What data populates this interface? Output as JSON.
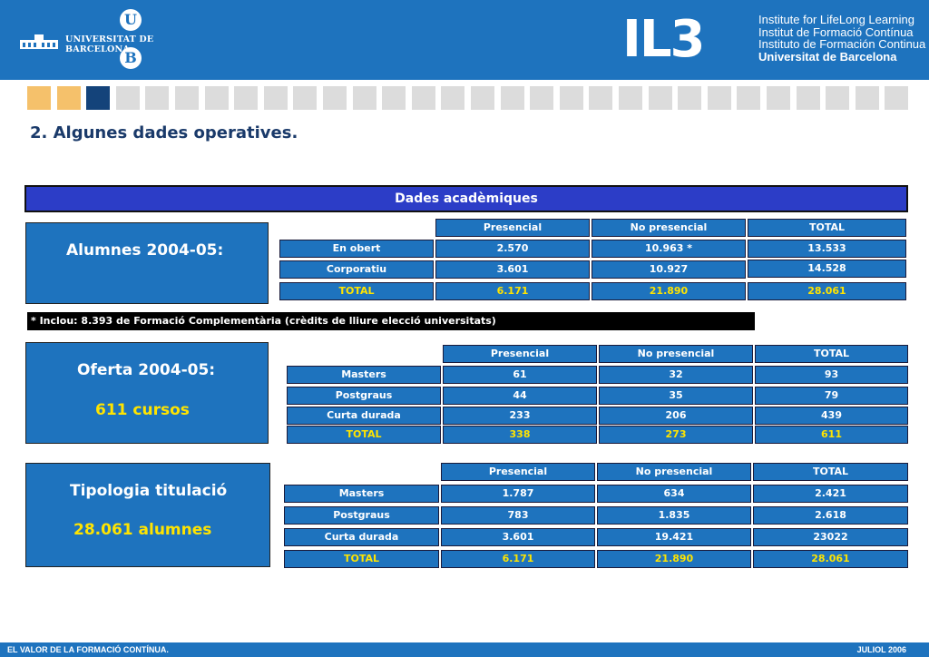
{
  "header": {
    "ub_letters": [
      "U",
      "B"
    ],
    "ub_name": "UNIVERSITAT DE BARCELONA",
    "il3": "IL3",
    "il3_lines": [
      "Institute for LifeLong Learning",
      "Institut de Formació Contínua",
      "Instituto de Formación Continua",
      "Universitat de Barcelona"
    ]
  },
  "nav_squares": {
    "colors": [
      "#f5c16b",
      "#f5c16b",
      "#14437a"
    ],
    "count": 30,
    "default_color": "#dcdcdc"
  },
  "title": "2. Algunes dades operatives.",
  "banner": "Dades acadèmiques",
  "box1": {
    "title": "Alumnes 2004-05:"
  },
  "box2": {
    "title": "Oferta 2004-05:",
    "sub": "611 cursos"
  },
  "box3": {
    "title": "Tipologia titulació",
    "sub": "28.061 alumnes"
  },
  "table1": {
    "headers": [
      "Presencial",
      "No presencial",
      "TOTAL"
    ],
    "rows": [
      {
        "label": "En obert",
        "values": [
          "2.570",
          "10.963 *",
          "13.533"
        ]
      },
      {
        "label": "Corporatiu",
        "values": [
          "3.601",
          "10.927",
          "14.528"
        ]
      },
      {
        "label": "TOTAL",
        "values": [
          "6.171",
          "21.890",
          "28.061"
        ]
      }
    ]
  },
  "note": "* Inclou: 8.393 de Formació Complementària (crèdits de lliure elecció universitats)",
  "table2": {
    "headers": [
      "Presencial",
      "No presencial",
      "TOTAL"
    ],
    "rows": [
      {
        "label": "Masters",
        "values": [
          "61",
          "32",
          "93"
        ]
      },
      {
        "label": "Postgraus",
        "values": [
          "44",
          "35",
          "79"
        ]
      },
      {
        "label": "Curta durada",
        "values": [
          "233",
          "206",
          "439"
        ]
      },
      {
        "label": "TOTAL",
        "values": [
          "338",
          "273",
          "611"
        ]
      }
    ]
  },
  "table3": {
    "headers": [
      "Presencial",
      "No presencial",
      "TOTAL"
    ],
    "rows": [
      {
        "label": "Masters",
        "values": [
          "1.787",
          "634",
          "2.421"
        ]
      },
      {
        "label": "Postgraus",
        "values": [
          "783",
          "1.835",
          "2.618"
        ]
      },
      {
        "label": "Curta durada",
        "values": [
          "3.601",
          "19.421",
          "23022"
        ]
      },
      {
        "label": "TOTAL",
        "values": [
          "6.171",
          "21.890",
          "28.061"
        ]
      }
    ]
  },
  "footer": {
    "left": "EL VALOR DE LA FORMACIÓ CONTÍNUA.",
    "right": "JULIOL  2006"
  }
}
